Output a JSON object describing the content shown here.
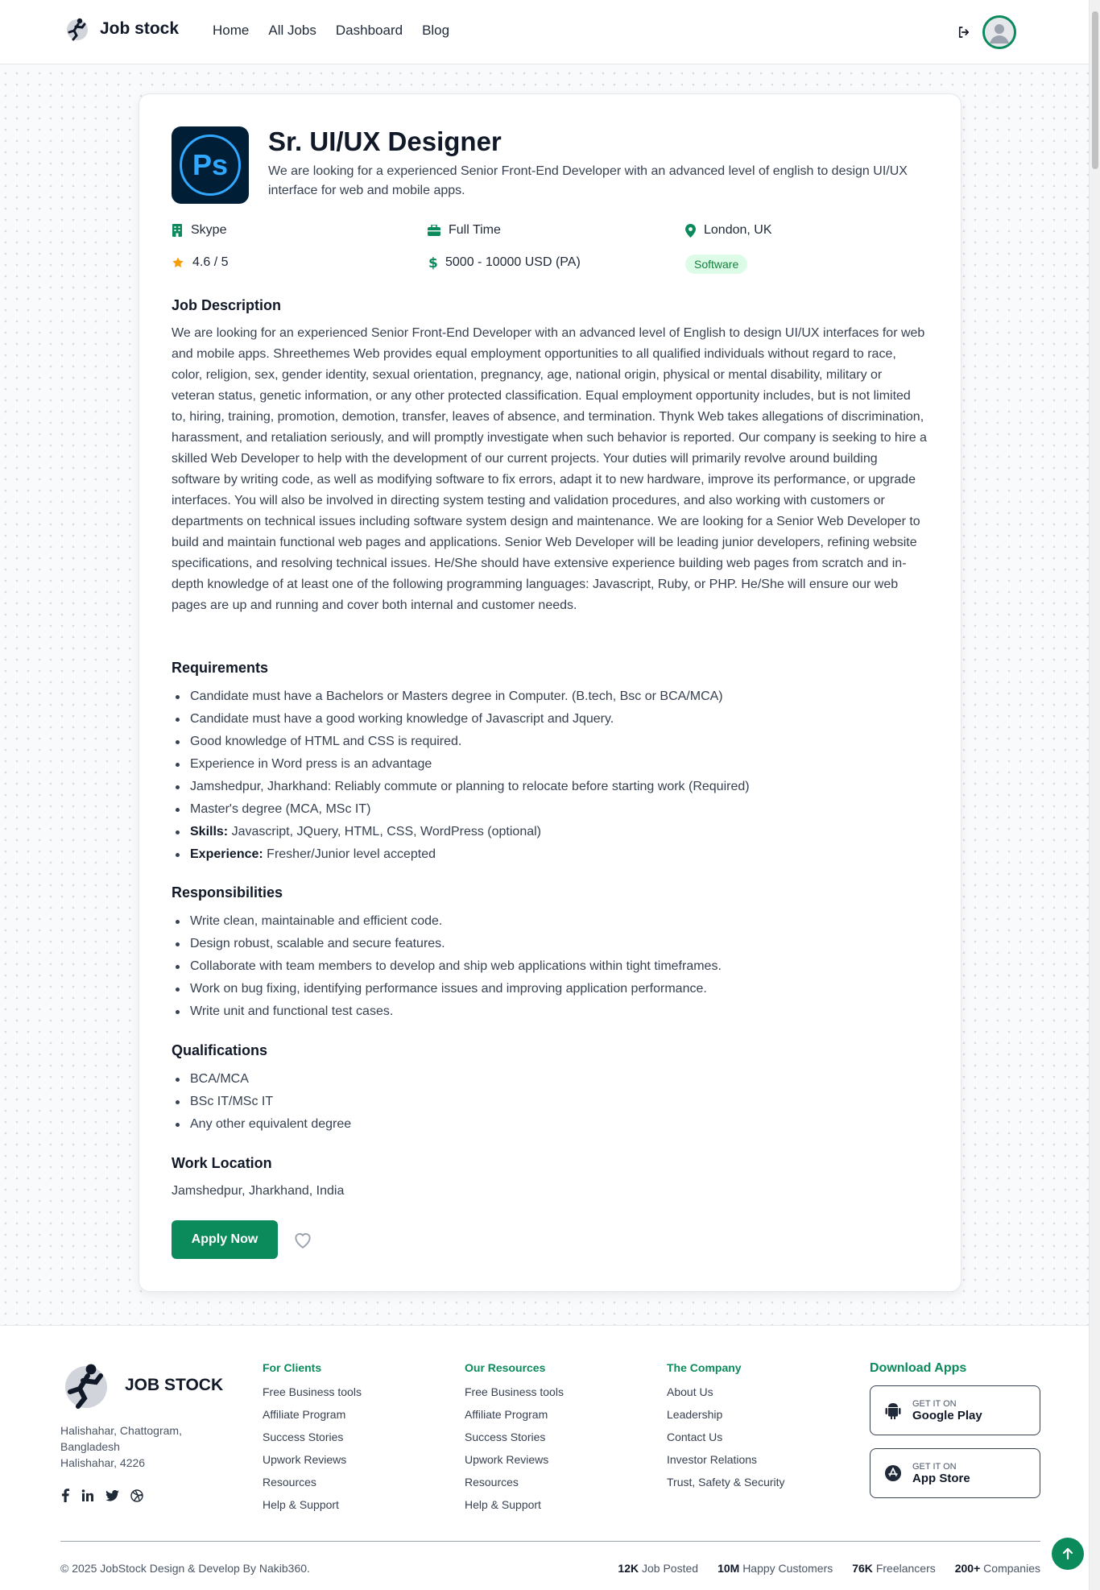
{
  "nav": {
    "brand": "Job stock",
    "links": [
      "Home",
      "All Jobs",
      "Dashboard",
      "Blog"
    ]
  },
  "job": {
    "title": "Sr. UI/UX Designer",
    "subtitle": "We are looking for a experienced Senior Front-End Developer with an advanced level of english to design UI/UX interface for web and mobile apps.",
    "logo_text": "Ps",
    "company": "Skype",
    "type": "Full Time",
    "location": "London, UK",
    "rating": "4.6 / 5",
    "salary": "5000 - 10000 USD (PA)",
    "category": "Software"
  },
  "description": {
    "heading": "Job Description",
    "text": "We are looking for an experienced Senior Front-End Developer with an advanced level of English to design UI/UX interfaces for web and mobile apps. Shreethemes Web provides equal employment opportunities to all qualified individuals without regard to race, color, religion, sex, gender identity, sexual orientation, pregnancy, age, national origin, physical or mental disability, military or veteran status, genetic information, or any other protected classification. Equal employment opportunity includes, but is not limited to, hiring, training, promotion, demotion, transfer, leaves of absence, and termination. Thynk Web takes allegations of discrimination, harassment, and retaliation seriously, and will promptly investigate when such behavior is reported. Our company is seeking to hire a skilled Web Developer to help with the development of our current projects. Your duties will primarily revolve around building software by writing code, as well as modifying software to fix errors, adapt it to new hardware, improve its performance, or upgrade interfaces. You will also be involved in directing system testing and validation procedures, and also working with customers or departments on technical issues including software system design and maintenance. We are looking for a Senior Web Developer to build and maintain functional web pages and applications. Senior Web Developer will be leading junior developers, refining website specifications, and resolving technical issues. He/She should have extensive experience building web pages from scratch and in-depth knowledge of at least one of the following programming languages: Javascript, Ruby, or PHP. He/She will ensure our web pages are up and running and cover both internal and customer needs."
  },
  "requirements": {
    "heading": "Requirements",
    "items": [
      "Candidate must have a Bachelors or Masters degree in Computer. (B.tech, Bsc or BCA/MCA)",
      "Candidate must have a good working knowledge of Javascript and Jquery.",
      "Good knowledge of HTML and CSS is required.",
      "Experience in Word press is an advantage",
      "Jamshedpur, Jharkhand: Reliably commute or planning to relocate before starting work (Required)",
      "Master's degree (MCA, MSc IT)"
    ],
    "skills_label": "Skills:",
    "skills_value": " Javascript, JQuery, HTML, CSS, WordPress (optional)",
    "experience_label": "Experience:",
    "experience_value": " Fresher/Junior level accepted"
  },
  "responsibilities": {
    "heading": "Responsibilities",
    "items": [
      "Write clean, maintainable and efficient code.",
      "Design robust, scalable and secure features.",
      "Collaborate with team members to develop and ship web applications within tight timeframes.",
      "Work on bug fixing, identifying performance issues and improving application performance.",
      "Write unit and functional test cases."
    ]
  },
  "qualifications": {
    "heading": "Qualifications",
    "items": [
      "BCA/MCA",
      "BSc IT/MSc IT",
      "Any other equivalent degree"
    ]
  },
  "work_location": {
    "heading": "Work Location",
    "text": "Jamshedpur, Jharkhand, India"
  },
  "actions": {
    "apply_label": "Apply Now"
  },
  "footer": {
    "brand": "JOB STOCK",
    "address": [
      "Halishahar, Chattogram,",
      "Bangladesh",
      "Halishahar, 4226"
    ],
    "col1": {
      "heading": "For Clients",
      "links": [
        "Free Business tools",
        "Affiliate Program",
        "Success Stories",
        "Upwork Reviews",
        "Resources",
        "Help & Support"
      ]
    },
    "col2": {
      "heading": "Our Resources",
      "links": [
        "Free Business tools",
        "Affiliate Program",
        "Success Stories",
        "Upwork Reviews",
        "Resources",
        "Help & Support"
      ]
    },
    "col3": {
      "heading": "The Company",
      "links": [
        "About Us",
        "Leadership",
        "Contact Us",
        "Investor Relations",
        "Trust, Safety & Security"
      ]
    },
    "apps": {
      "heading": "Download Apps",
      "google_small": "GET IT ON",
      "google_big": "Google Play",
      "apple_small": "GET IT ON",
      "apple_big": "App Store"
    },
    "copyright": "© 2025 JobStock Design & Develop By Nakib360.",
    "stats": [
      {
        "value": "12K",
        "label": "Job Posted"
      },
      {
        "value": "10M",
        "label": "Happy Customers"
      },
      {
        "value": "76K",
        "label": "Freelancers"
      },
      {
        "value": "200+",
        "label": "Companies"
      }
    ]
  },
  "colors": {
    "accent": "#0b8a5c",
    "chip_bg": "#dcfce7",
    "star": "#f59e0b"
  }
}
